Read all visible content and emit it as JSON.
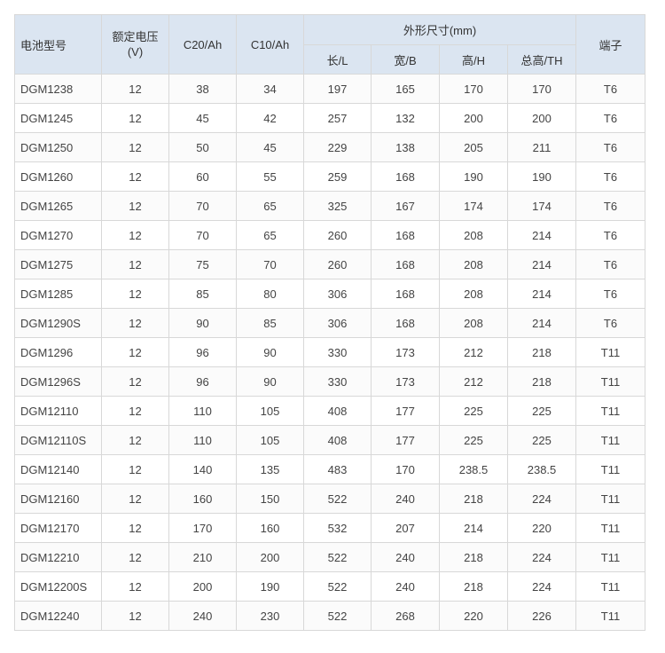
{
  "table": {
    "headers": {
      "model": "电池型号",
      "voltage": "额定电压\n(V)",
      "c20": "C20/Ah",
      "c10": "C10/Ah",
      "dimensions": "外形尺寸(mm)",
      "length": "长/L",
      "width": "宽/B",
      "height": "高/H",
      "total_height": "总高/TH",
      "terminal": "端子"
    },
    "rows": [
      [
        "DGM1238",
        "12",
        "38",
        "34",
        "197",
        "165",
        "170",
        "170",
        "T6"
      ],
      [
        "DGM1245",
        "12",
        "45",
        "42",
        "257",
        "132",
        "200",
        "200",
        "T6"
      ],
      [
        "DGM1250",
        "12",
        "50",
        "45",
        "229",
        "138",
        "205",
        "211",
        "T6"
      ],
      [
        "DGM1260",
        "12",
        "60",
        "55",
        "259",
        "168",
        "190",
        "190",
        "T6"
      ],
      [
        "DGM1265",
        "12",
        "70",
        "65",
        "325",
        "167",
        "174",
        "174",
        "T6"
      ],
      [
        "DGM1270",
        "12",
        "70",
        "65",
        "260",
        "168",
        "208",
        "214",
        "T6"
      ],
      [
        "DGM1275",
        "12",
        "75",
        "70",
        "260",
        "168",
        "208",
        "214",
        "T6"
      ],
      [
        "DGM1285",
        "12",
        "85",
        "80",
        "306",
        "168",
        "208",
        "214",
        "T6"
      ],
      [
        "DGM1290S",
        "12",
        "90",
        "85",
        "306",
        "168",
        "208",
        "214",
        "T6"
      ],
      [
        "DGM1296",
        "12",
        "96",
        "90",
        "330",
        "173",
        "212",
        "218",
        "T11"
      ],
      [
        "DGM1296S",
        "12",
        "96",
        "90",
        "330",
        "173",
        "212",
        "218",
        "T11"
      ],
      [
        "DGM12110",
        "12",
        "110",
        "105",
        "408",
        "177",
        "225",
        "225",
        "T11"
      ],
      [
        "DGM12110S",
        "12",
        "110",
        "105",
        "408",
        "177",
        "225",
        "225",
        "T11"
      ],
      [
        "DGM12140",
        "12",
        "140",
        "135",
        "483",
        "170",
        "238.5",
        "238.5",
        "T11"
      ],
      [
        "DGM12160",
        "12",
        "160",
        "150",
        "522",
        "240",
        "218",
        "224",
        "T11"
      ],
      [
        "DGM12170",
        "12",
        "170",
        "160",
        "532",
        "207",
        "214",
        "220",
        "T11"
      ],
      [
        "DGM12210",
        "12",
        "210",
        "200",
        "522",
        "240",
        "218",
        "224",
        "T11"
      ],
      [
        "DGM12200S",
        "12",
        "200",
        "190",
        "522",
        "240",
        "218",
        "224",
        "T11"
      ],
      [
        "DGM12240",
        "12",
        "240",
        "230",
        "522",
        "268",
        "220",
        "226",
        "T11"
      ]
    ]
  }
}
